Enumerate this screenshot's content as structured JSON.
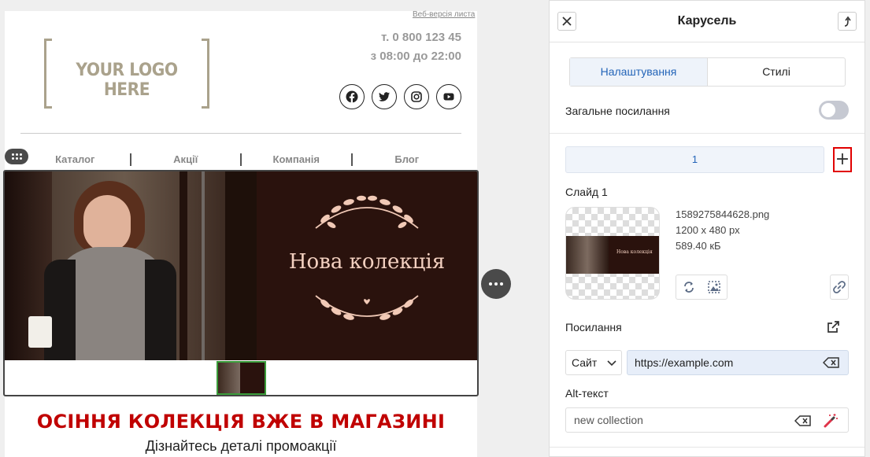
{
  "email": {
    "web_version": "Веб-версія листа",
    "logo_text": "YOUR LOGO HERE",
    "phone": "т. 0 800 123 45",
    "hours": "з 08:00 до 22:00",
    "socials": [
      "facebook-icon",
      "twitter-icon",
      "instagram-icon",
      "youtube-icon"
    ],
    "nav": [
      "Каталог",
      "Акції",
      "Компанія",
      "Блог"
    ],
    "banner_heading": "Нова колекція",
    "headline": "ОСІННЯ КОЛЕКЦІЯ ВЖЕ В МАГАЗИНІ",
    "subline": "Дізнайтесь деталі промоакції"
  },
  "panel": {
    "title": "Карусель",
    "tabs": [
      "Налаштування",
      "Стилі"
    ],
    "active_tab": 0,
    "general_link_label": "Загальне посилання",
    "general_link_enabled": false,
    "slide_selector": "1",
    "add_slide": "+",
    "slide_label": "Слайд 1",
    "file_name": "1589275844628.png",
    "file_dims": "1200 x 480 px",
    "file_size": "589.40 кБ",
    "preview_text": "Нова колекція",
    "link_label": "Посилання",
    "link_type": "Сайт",
    "link_url": "https://example.com",
    "alt_label": "Alt-текст",
    "alt_value": "new collection"
  },
  "colors": {
    "accent": "#2364b8",
    "headline_red": "#c00000",
    "highlight_red": "#e10000",
    "logo_tan": "#aaa28c",
    "thumb_border": "#3a9c3a"
  }
}
